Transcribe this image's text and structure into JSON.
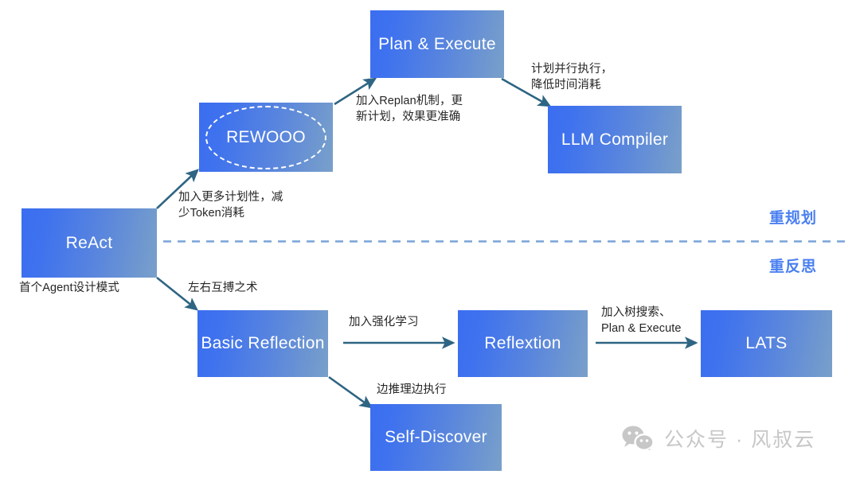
{
  "diagram": {
    "title": "Agent Design Patterns Evolution",
    "accent_box_gradient_start": "#3b6ef0",
    "accent_box_gradient_end": "#79a0c9",
    "arrow_color": "#2e6583",
    "divider_color": "#7aa3d8",
    "side_label_color": "#4a7ff0",
    "watermark_color": "#c7c7c7"
  },
  "nodes": [
    {
      "id": "react",
      "label": "ReAct"
    },
    {
      "id": "rewooo",
      "label": "REWOOO"
    },
    {
      "id": "plan",
      "label": "Plan & Execute"
    },
    {
      "id": "compiler",
      "label": "LLM Compiler"
    },
    {
      "id": "basic",
      "label": "Basic Reflection"
    },
    {
      "id": "reflextion",
      "label": "Reflextion"
    },
    {
      "id": "lats",
      "label": "LATS"
    },
    {
      "id": "selfdiscover",
      "label": "Self-Discover"
    }
  ],
  "edge_labels": {
    "react_to_rewooo": "加入更多计划性，减\n少Token消耗",
    "rewooo_to_plan": "加入Replan机制，更\n新计划，效果更准确",
    "plan_to_compiler": "计划并行执行，\n降低时间消耗",
    "react_caption": "首个Agent设计模式",
    "react_to_basic": "左右互搏之术",
    "basic_to_reflextion": "加入强化学习",
    "reflextion_to_lats": "加入树搜索、\nPlan & Execute",
    "basic_to_selfdiscover": "边推理边执行"
  },
  "side_labels": {
    "top": "重规划",
    "bottom": "重反思"
  },
  "watermark": {
    "icon": "wechat-icon",
    "text": "公众号 · 风叔云"
  }
}
